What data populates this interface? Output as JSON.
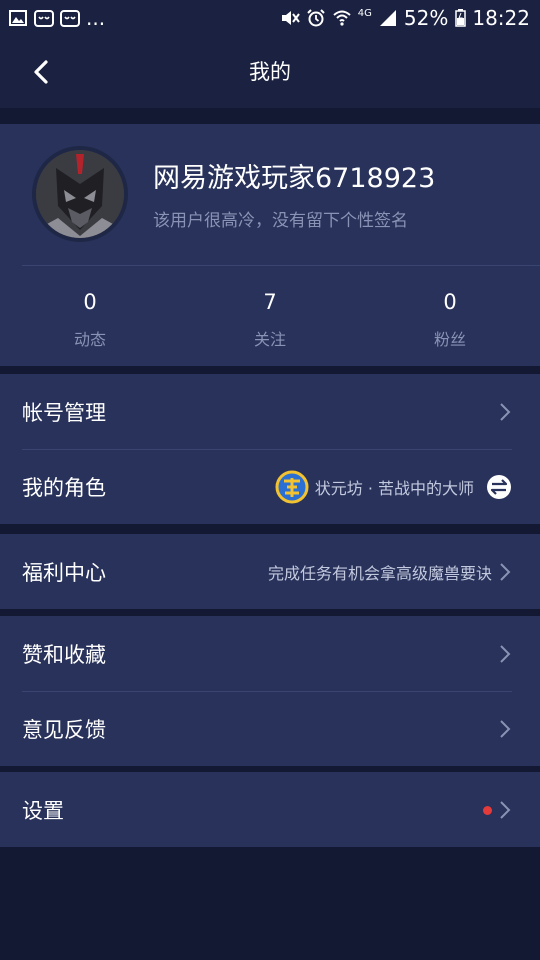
{
  "status_bar": {
    "left_icons": [
      "image-icon",
      "app-icon",
      "app-icon"
    ],
    "more": "...",
    "network": "4G",
    "battery": "52%",
    "time": "18:22"
  },
  "header": {
    "title": "我的"
  },
  "profile": {
    "username": "网易游戏玩家6718923",
    "signature": "该用户很高冷，没有留下个性签名",
    "stats": [
      {
        "value": "0",
        "label": "动态"
      },
      {
        "value": "7",
        "label": "关注"
      },
      {
        "value": "0",
        "label": "粉丝"
      }
    ]
  },
  "menu": {
    "account": {
      "label": "帐号管理"
    },
    "role": {
      "label": "我的角色",
      "value": "状元坊 · 苦战中的大师"
    },
    "welfare": {
      "label": "福利中心",
      "value": "完成任务有机会拿高级魔兽要诀"
    },
    "likes": {
      "label": "赞和收藏"
    },
    "feedback": {
      "label": "意见反馈"
    },
    "settings": {
      "label": "设置"
    }
  },
  "colors": {
    "background": "#141933",
    "card": "#28325a",
    "header": "#1b2241",
    "muted_text": "#8a93b5",
    "badge_red": "#e53a3a"
  }
}
